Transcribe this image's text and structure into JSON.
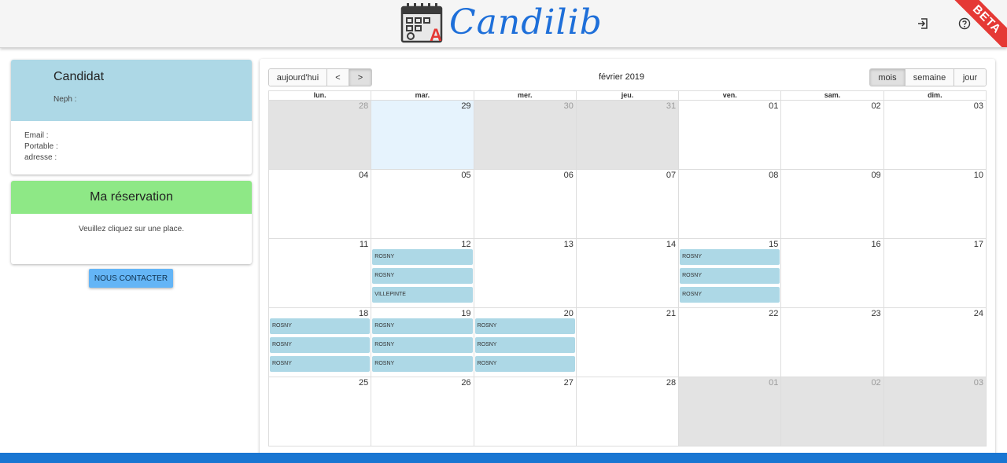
{
  "header": {
    "app_name": "Candilib",
    "badge": "BETA",
    "logo_icon": "calendar-a-logo-icon",
    "logout_icon": "login-arrow-icon",
    "help_icon": "help-circle-icon",
    "logo_letter": "A"
  },
  "candidate": {
    "title": "Candidat",
    "neph_label": "Neph :",
    "email_label": "Email :",
    "phone_label": "Portable :",
    "address_label": "adresse :"
  },
  "reservation": {
    "title": "Ma réservation",
    "message": "Veuillez cliquez sur une place."
  },
  "contact_button": "NOUS CONTACTER",
  "calendar": {
    "toolbar": {
      "today": "aujourd'hui",
      "prev": "<",
      "next": ">",
      "title": "février 2019",
      "views": [
        {
          "label": "mois",
          "active": true
        },
        {
          "label": "semaine",
          "active": false
        },
        {
          "label": "jour",
          "active": false
        }
      ]
    },
    "days_of_week": [
      "lun.",
      "mar.",
      "mer.",
      "jeu.",
      "ven.",
      "sam.",
      "dim."
    ],
    "weeks": [
      [
        {
          "date": "28",
          "other": true,
          "events": []
        },
        {
          "date": "29",
          "today": true,
          "events": []
        },
        {
          "date": "30",
          "other": true,
          "events": []
        },
        {
          "date": "31",
          "other": true,
          "events": []
        },
        {
          "date": "01",
          "events": []
        },
        {
          "date": "02",
          "events": []
        },
        {
          "date": "03",
          "events": []
        }
      ],
      [
        {
          "date": "04",
          "events": []
        },
        {
          "date": "05",
          "events": []
        },
        {
          "date": "06",
          "events": []
        },
        {
          "date": "07",
          "events": []
        },
        {
          "date": "08",
          "events": []
        },
        {
          "date": "09",
          "events": []
        },
        {
          "date": "10",
          "events": []
        }
      ],
      [
        {
          "date": "11",
          "events": []
        },
        {
          "date": "12",
          "events": [
            "ROSNY",
            "ROSNY",
            "VILLEPINTE"
          ]
        },
        {
          "date": "13",
          "events": []
        },
        {
          "date": "14",
          "events": []
        },
        {
          "date": "15",
          "events": [
            "ROSNY",
            "ROSNY",
            "ROSNY"
          ]
        },
        {
          "date": "16",
          "events": []
        },
        {
          "date": "17",
          "events": []
        }
      ],
      [
        {
          "date": "18",
          "events": [
            "ROSNY",
            "ROSNY",
            "ROSNY"
          ]
        },
        {
          "date": "19",
          "events": [
            "ROSNY",
            "ROSNY",
            "ROSNY"
          ]
        },
        {
          "date": "20",
          "events": [
            "ROSNY",
            "ROSNY",
            "ROSNY"
          ]
        },
        {
          "date": "21",
          "events": []
        },
        {
          "date": "22",
          "events": []
        },
        {
          "date": "23",
          "events": []
        },
        {
          "date": "24",
          "events": []
        }
      ],
      [
        {
          "date": "25",
          "events": []
        },
        {
          "date": "26",
          "events": []
        },
        {
          "date": "27",
          "events": []
        },
        {
          "date": "28",
          "events": []
        },
        {
          "date": "01",
          "other": true,
          "events": []
        },
        {
          "date": "02",
          "other": true,
          "events": []
        },
        {
          "date": "03",
          "other": true,
          "events": []
        }
      ]
    ]
  },
  "colors": {
    "candidate_header": "#add8e6",
    "reservation_header": "#8ee886",
    "event": "#add8e6",
    "brand": "#1e6fd9",
    "beta": "#e53935",
    "contact_button": "#64b5f6",
    "bottom_band": "#1976d2"
  }
}
